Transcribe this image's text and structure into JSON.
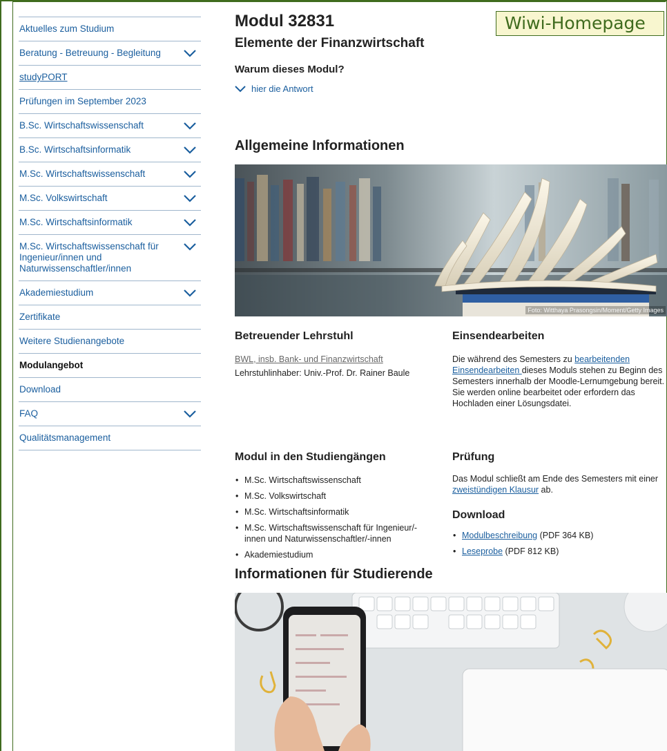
{
  "badge": {
    "label": "Wiwi-Homepage"
  },
  "sidebar": {
    "items": [
      {
        "label": "Aktuelles zum Studium",
        "chevron": false,
        "style": "link"
      },
      {
        "label": "Beratung - Betreuung - Begleitung",
        "chevron": true,
        "style": "link"
      },
      {
        "label": "studyPORT",
        "chevron": false,
        "style": "underline"
      },
      {
        "label": "Prüfungen im September 2023",
        "chevron": false,
        "style": "link"
      },
      {
        "label": "B.Sc. Wirtschaftswissenschaft",
        "chevron": true,
        "style": "link"
      },
      {
        "label": "B.Sc. Wirtschaftsinformatik",
        "chevron": true,
        "style": "link"
      },
      {
        "label": "M.Sc. Wirtschaftswissenschaft",
        "chevron": true,
        "style": "link"
      },
      {
        "label": "M.Sc. Volkswirtschaft",
        "chevron": true,
        "style": "link"
      },
      {
        "label": "M.Sc. Wirtschaftsinformatik",
        "chevron": true,
        "style": "link"
      },
      {
        "label": "M.Sc. Wirtschaftswissenschaft für Ingenieur/innen und Naturwissenschaftler/innen",
        "chevron": true,
        "style": "link"
      },
      {
        "label": "Akademiestudium",
        "chevron": true,
        "style": "link"
      },
      {
        "label": "Zertifikate",
        "chevron": false,
        "style": "link"
      },
      {
        "label": "Weitere Studienangebote",
        "chevron": false,
        "style": "link"
      },
      {
        "label": "Modulangebot",
        "chevron": false,
        "style": "active"
      },
      {
        "label": "Download",
        "chevron": false,
        "style": "link"
      },
      {
        "label": "FAQ",
        "chevron": true,
        "style": "link"
      },
      {
        "label": "Qualitätsmanagement",
        "chevron": false,
        "style": "link"
      }
    ]
  },
  "main": {
    "title": "Modul 32831",
    "subtitle": "Elemente der Finanzwirtschaft",
    "why_heading": "Warum dieses Modul?",
    "answer_link": "hier die Antwort",
    "general_heading": "Allgemeine Informationen",
    "photo_credit": "Foto: Witthaya Prasongsin/Moment/Getty Images",
    "chair": {
      "heading": "Betreuender Lehrstuhl",
      "link": "BWL, insb. Bank- und Finanzwirtschaft",
      "holder": "Lehrstuhlinhaber: Univ.-Prof. Dr. Rainer Baule"
    },
    "assignments": {
      "heading": "Einsendearbeiten",
      "text_before": "Die während des Semesters zu ",
      "link": "bearbeitenden Einsendearbeiten ",
      "text_after": "dieses Moduls stehen zu Beginn des Semesters innerhalb der Moodle-Lernumgebung bereit. Sie werden online bearbeitet oder erfordern das Hochladen einer Lösungsdatei."
    },
    "programs": {
      "heading": "Modul in den Studiengängen",
      "items": [
        "M.Sc. Wirtschaftswissenschaft",
        "M.Sc. Volkswirtschaft",
        "M.Sc. Wirtschaftsinformatik",
        "M.Sc. Wirtschaftswissenschaft für Ingenieur/-innen und Naturwissenschaftler/-innen",
        "Akademiestudium"
      ]
    },
    "exam": {
      "heading": "Prüfung",
      "text_before": "Das Modul schließt am Ende des Semesters mit einer ",
      "link": "zweistündigen Klausur",
      "text_after": " ab."
    },
    "download": {
      "heading": "Download",
      "items": [
        {
          "link": "Modulbeschreibung",
          "meta": " (PDF 364 KB)"
        },
        {
          "link": "Leseprobe",
          "meta": " (PDF 812 KB)"
        }
      ]
    },
    "students_heading": "Informationen für Studierende"
  },
  "colors": {
    "link": "#1a5e9e",
    "frame": "#3f6b1e",
    "badge_bg": "#f8f6cf"
  },
  "icons": {
    "nav_chevron": "chevron-down-icon"
  }
}
